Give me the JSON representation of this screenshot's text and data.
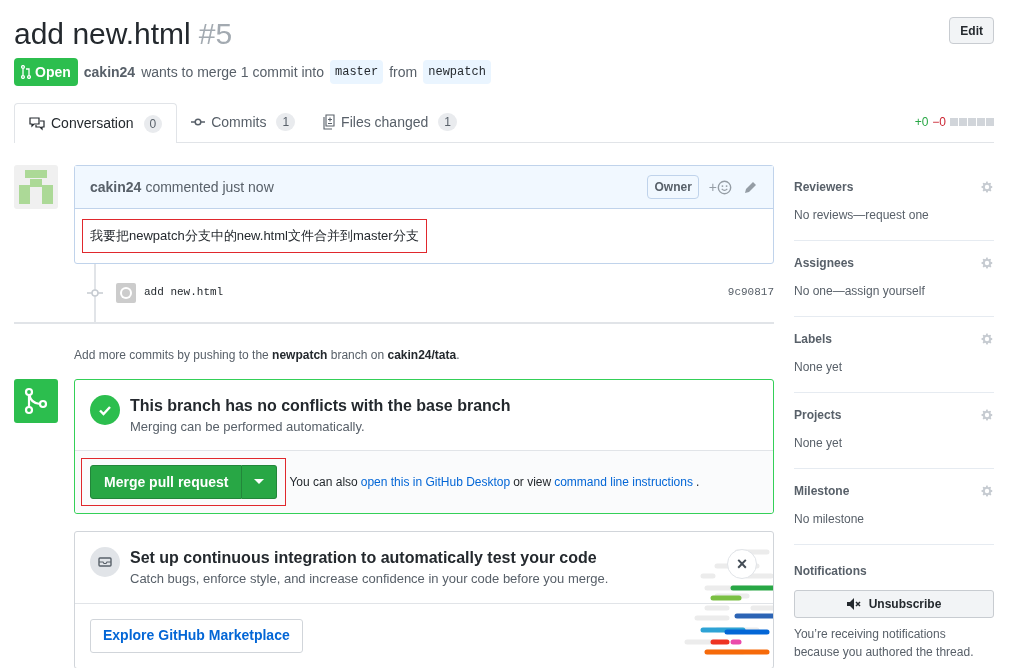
{
  "header": {
    "title": "add new.html",
    "number": "#5",
    "edit_button": "Edit",
    "status": "Open",
    "author": "cakin24",
    "merge_text": "wants to merge 1 commit into",
    "base_branch": "master",
    "from_text": "from",
    "head_branch": "newpatch"
  },
  "tabs": [
    {
      "label": "Conversation",
      "count": "0",
      "selected": true
    },
    {
      "label": "Commits",
      "count": "1",
      "selected": false
    },
    {
      "label": "Files changed",
      "count": "1",
      "selected": false
    }
  ],
  "diffstat": {
    "added": "+0",
    "removed": "−0"
  },
  "comment": {
    "author": "cakin24",
    "action": "commented just now",
    "badge": "Owner",
    "reaction": "+",
    "body": "我要把newpatch分支中的new.html文件合并到master分支"
  },
  "commit": {
    "message": "add new.html",
    "sha": "9c90817"
  },
  "push_hint": "Add more commits by pushing to the **newpatch** branch on **cakin24/tata**.",
  "merge": {
    "title": "This branch has no conflicts with the base branch",
    "subtitle": "Merging can be performed automatically.",
    "button": "Merge pull request",
    "hint_parts": [
      {
        "kind": "text",
        "text": "You can also"
      },
      {
        "kind": "link",
        "text": "open this in GitHub Desktop"
      },
      {
        "kind": "text",
        "text": "or view"
      },
      {
        "kind": "link",
        "text": "command line instructions"
      },
      {
        "kind": "text",
        "text": "."
      }
    ]
  },
  "ci": {
    "title": "Set up continuous integration to automatically test your code",
    "subtitle": "Catch bugs, enforce style, and increase confidence in your code before you merge.",
    "button": "Explore GitHub Marketplace",
    "close": "×"
  },
  "sidebar": {
    "sections": [
      {
        "title": "Reviewers",
        "value": "No reviews—request one"
      },
      {
        "title": "Assignees",
        "value": "No one—assign yourself"
      },
      {
        "title": "Labels",
        "value": "None yet"
      },
      {
        "title": "Projects",
        "value": "None yet"
      },
      {
        "title": "Milestone",
        "value": "No milestone"
      }
    ],
    "notifications": {
      "title": "Notifications",
      "button": "Unsubscribe",
      "note": "You’re receiving notifications because you authored the thread."
    }
  }
}
